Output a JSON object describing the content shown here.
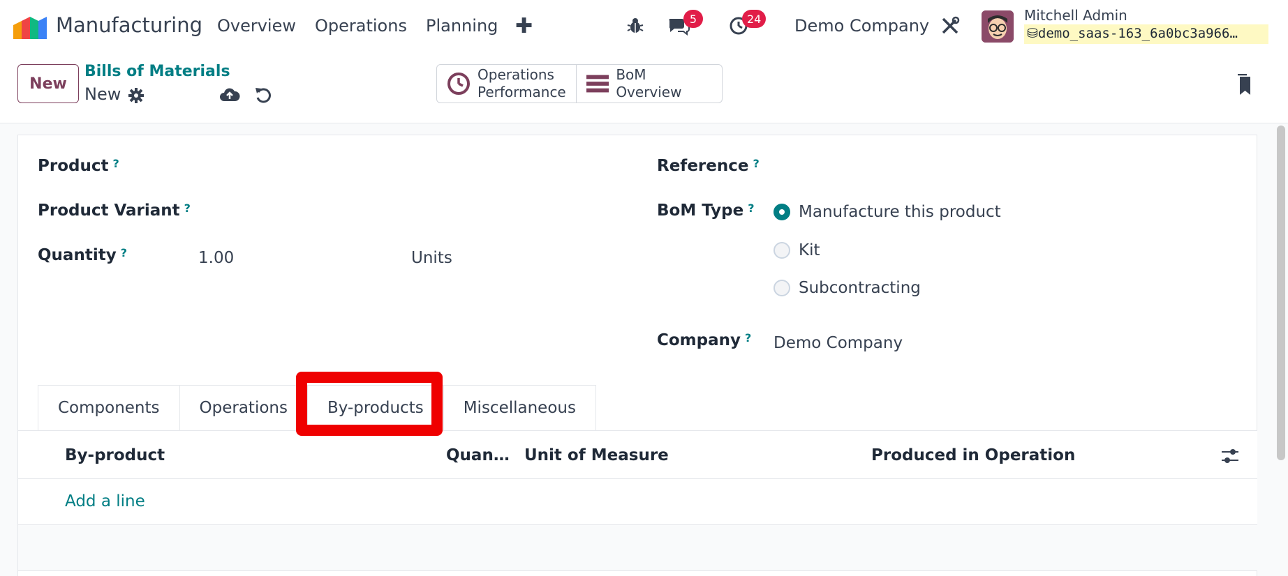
{
  "navbar": {
    "app_name": "Manufacturing",
    "menu": [
      "Overview",
      "Operations",
      "Planning"
    ],
    "messages_count": "5",
    "activities_count": "24",
    "company": "Demo Company",
    "user_name": "Mitchell Admin",
    "database": "demo_saas-163_6a0bc3a966…"
  },
  "control": {
    "new_label": "New",
    "breadcrumb": "Bills of Materials",
    "record_name": "New",
    "smart_buttons": [
      {
        "line1": "Operations",
        "line2": "Performance"
      },
      {
        "label": "BoM Overview"
      }
    ]
  },
  "form": {
    "product_label": "Product",
    "variant_label": "Product Variant",
    "quantity_label": "Quantity",
    "quantity_value": "1.00",
    "uom_value": "Units",
    "reference_label": "Reference",
    "bom_type_label": "BoM Type",
    "bom_types": [
      "Manufacture this product",
      "Kit",
      "Subcontracting"
    ],
    "bom_type_selected": "Manufacture this product",
    "company_label": "Company",
    "company_value": "Demo Company",
    "help_mark": "?"
  },
  "tabs": [
    "Components",
    "Operations",
    "By-products",
    "Miscellaneous"
  ],
  "active_tab": "By-products",
  "table": {
    "columns": [
      "By-product",
      "Quan…",
      "Unit of Measure",
      "Produced in Operation"
    ],
    "add_line": "Add a line"
  },
  "colors": {
    "brand": "#7c3f5c",
    "accent": "#017e84",
    "badge": "#e11d48",
    "highlight": "#ef0000"
  }
}
